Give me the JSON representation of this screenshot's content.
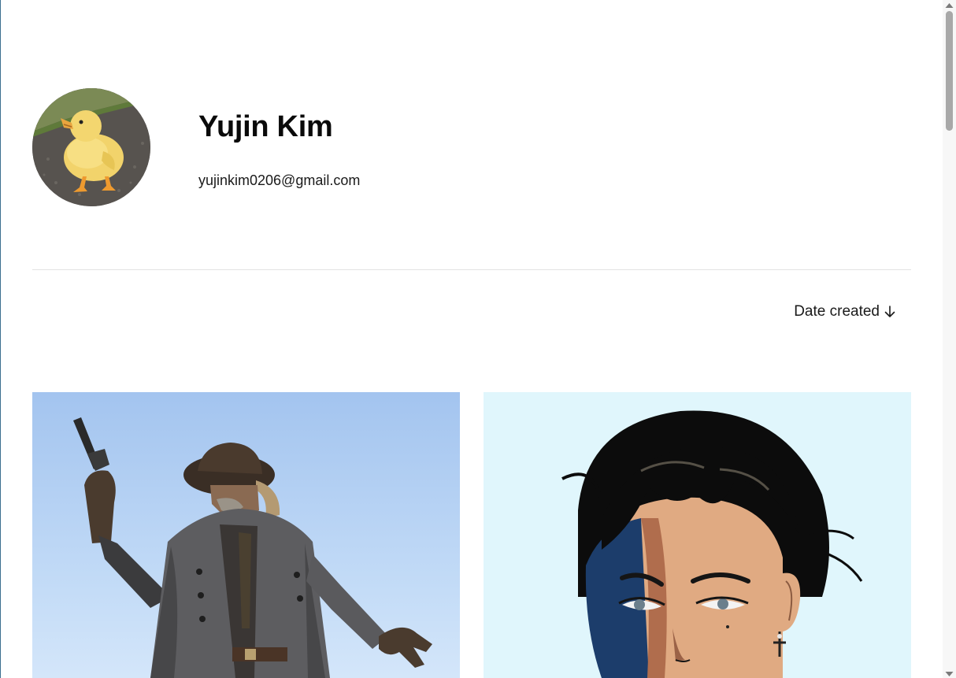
{
  "profile": {
    "name": "Yujin Kim",
    "email": "yujinkim0206@gmail.com"
  },
  "sort": {
    "label": "Date created",
    "direction_icon": "arrow-down-icon"
  },
  "gallery": {
    "items": [
      {
        "description": "Cowboy illustration with revolver"
      },
      {
        "description": "Anime portrait with dark hair"
      }
    ]
  },
  "colors": {
    "background": "#ffffff",
    "divider": "#e3e3e3",
    "text": "#111111",
    "card_1_sky": "#a3c4ef",
    "card_2_bg": "#e0f6fc"
  }
}
